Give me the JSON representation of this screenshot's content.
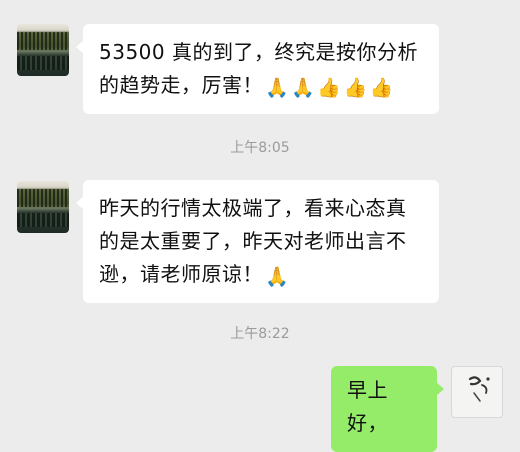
{
  "messages": [
    {
      "side": "left",
      "text": "53500 真的到了，终究是按你分析的趋势走，厉害！",
      "emojis": [
        "🙏",
        "🙏",
        "👍",
        "👍",
        "👍"
      ]
    },
    {
      "side": "left",
      "text": "昨天的行情太极端了，看来心态真的是太重要了，昨天对老师出言不逊，请老师原谅！",
      "emojis": [
        "🙏"
      ]
    },
    {
      "side": "right",
      "text": "早上好，"
    }
  ],
  "timestamps": [
    "上午8:05",
    "上午8:22"
  ],
  "colors": {
    "background": "#ececec",
    "incoming_bubble": "#ffffff",
    "outgoing_bubble": "#95ec69",
    "timestamp_text": "#9b9b9b"
  }
}
